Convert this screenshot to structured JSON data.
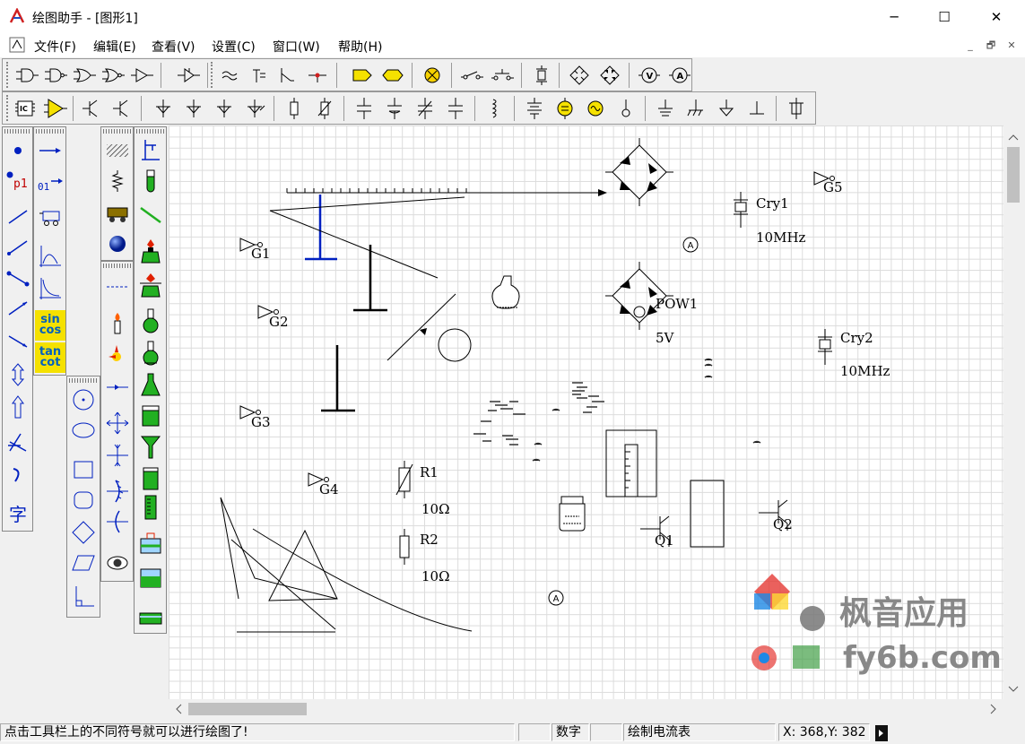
{
  "window": {
    "title": "绘图助手 - [图形1]",
    "minimize": "─",
    "maximize": "☐",
    "close": "✕"
  },
  "menu": {
    "items": [
      "文件(F)",
      "编辑(E)",
      "查看(V)",
      "设置(C)",
      "窗口(W)",
      "帮助(H)"
    ],
    "mdi_controls": [
      "_",
      "🗗",
      "✕"
    ]
  },
  "side_palette": {
    "point_label": "p1",
    "point_number_label": "01",
    "sin_label": "sin",
    "cos_label": "cos",
    "tan_label": "tan",
    "cot_label": "cot",
    "text_tool": "字"
  },
  "canvas": {
    "labels": {
      "g1": "G1",
      "g2": "G2",
      "g3": "G3",
      "g4": "G4",
      "g5": "G5",
      "cry1": "Cry1",
      "cry1_freq": "10MHz",
      "cry2": "Cry2",
      "cry2_freq": "10MHz",
      "pow1": "POW1",
      "pow1_volt": "5V",
      "r1": "R1",
      "r1_val": "10Ω",
      "r2": "R2",
      "r2_val": "10Ω",
      "q1": "Q1",
      "q2": "Q2",
      "ammeter": "A"
    }
  },
  "watermark": {
    "name": "枫音应用",
    "domain": "fy6b.com"
  },
  "statusbar": {
    "hint": "点击工具栏上的不同符号就可以进行绘图了!",
    "mode": "数字",
    "current_tool": "绘制电流表",
    "coords": "X: 368,Y: 382"
  },
  "colors": {
    "accent_blue": "#0020c0",
    "green_flask": "#22b022",
    "watermark_gray": "#888888"
  }
}
